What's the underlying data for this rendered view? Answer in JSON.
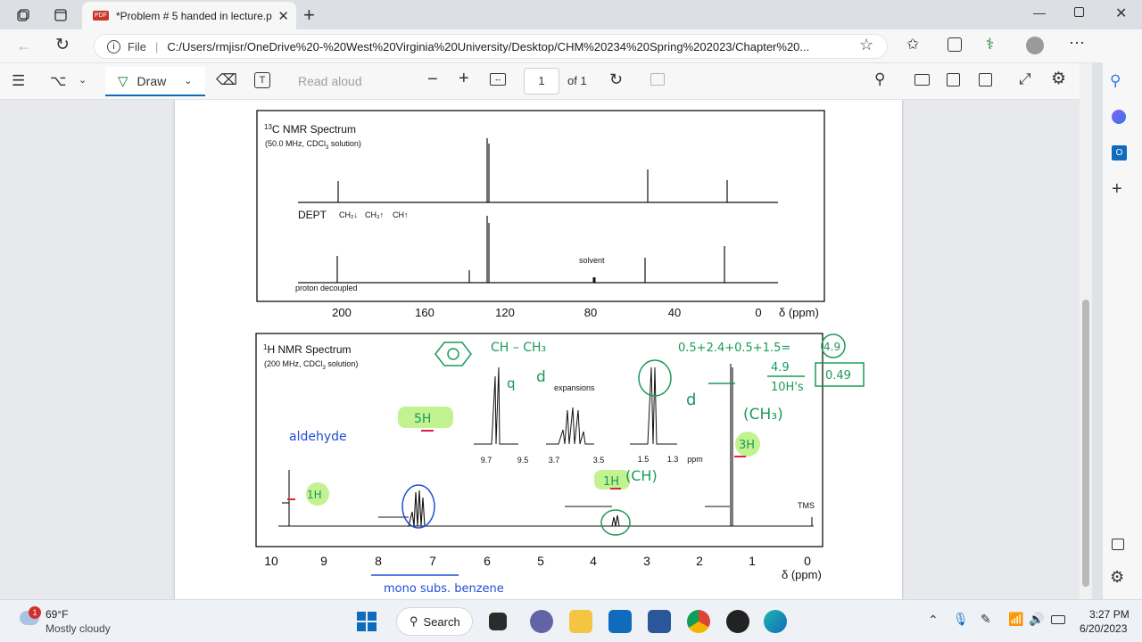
{
  "tab": {
    "title": "*Problem # 5 handed in lecture.p",
    "pdf_badge": "PDF"
  },
  "address": {
    "file_label": "File",
    "url": "C:/Users/rmjisr/OneDrive%20-%20West%20Virginia%20University/Desktop/CHM%20234%20Spring%202023/Chapter%20..."
  },
  "toolbar": {
    "draw_label": "Draw",
    "read_aloud": "Read aloud",
    "page_value": "1",
    "page_of": "of 1"
  },
  "c13": {
    "title": "NMR Spectrum",
    "title_sup": "13",
    "title_prefix": "C",
    "subtitle": "(50.0 MHz, CDCl",
    "subtitle_sub": "3",
    "subtitle_end": " solution)",
    "dept": "DEPT",
    "dept_ch2": "CH₂↓",
    "dept_ch3": "CH₃↑",
    "dept_ch": "CH↑",
    "solvent": "solvent",
    "proton_decoupled": "proton decoupled",
    "ticks": [
      "200",
      "160",
      "120",
      "80",
      "40",
      "0"
    ],
    "axis_label": "δ (ppm)"
  },
  "h1": {
    "title": "NMR Spectrum",
    "title_sup": "1",
    "title_prefix": "H",
    "subtitle": "(200 MHz, CDCl",
    "subtitle_sub": "3",
    "subtitle_end": " solution)",
    "expansions": "expansions",
    "exp_ticks": [
      "9.7",
      "9.5",
      "3.7",
      "3.5",
      "1.5",
      "1.3",
      "ppm"
    ],
    "tms": "TMS",
    "ticks": [
      "10",
      "9",
      "8",
      "7",
      "6",
      "5",
      "4",
      "3",
      "2",
      "1",
      "0"
    ],
    "axis_label": "δ (ppm)"
  },
  "annotations": {
    "aldehyde": "aldehyde",
    "one_h": "1H",
    "five_h": "5H",
    "one_h_ch": "1H",
    "ch_label": "(CH)",
    "three_h": "3H",
    "ch3_label": "(CH₃)",
    "d_label": "d",
    "q_label": "q",
    "d_label2": "d",
    "sum": "0.5+2.4+0.5+1.5=",
    "sum_total": "4.9",
    "ratio_num": "4.9",
    "ratio_den": "10H's",
    "ratio_val": "0.49",
    "mono": "mono subs. benzene",
    "structure_ch": "CH – CH₃"
  },
  "weather": {
    "temp": "69°F",
    "condition": "Mostly cloudy",
    "badge": "1"
  },
  "taskbar": {
    "search": "Search"
  },
  "clock": {
    "time": "3:27 PM",
    "date": "6/20/2023"
  }
}
